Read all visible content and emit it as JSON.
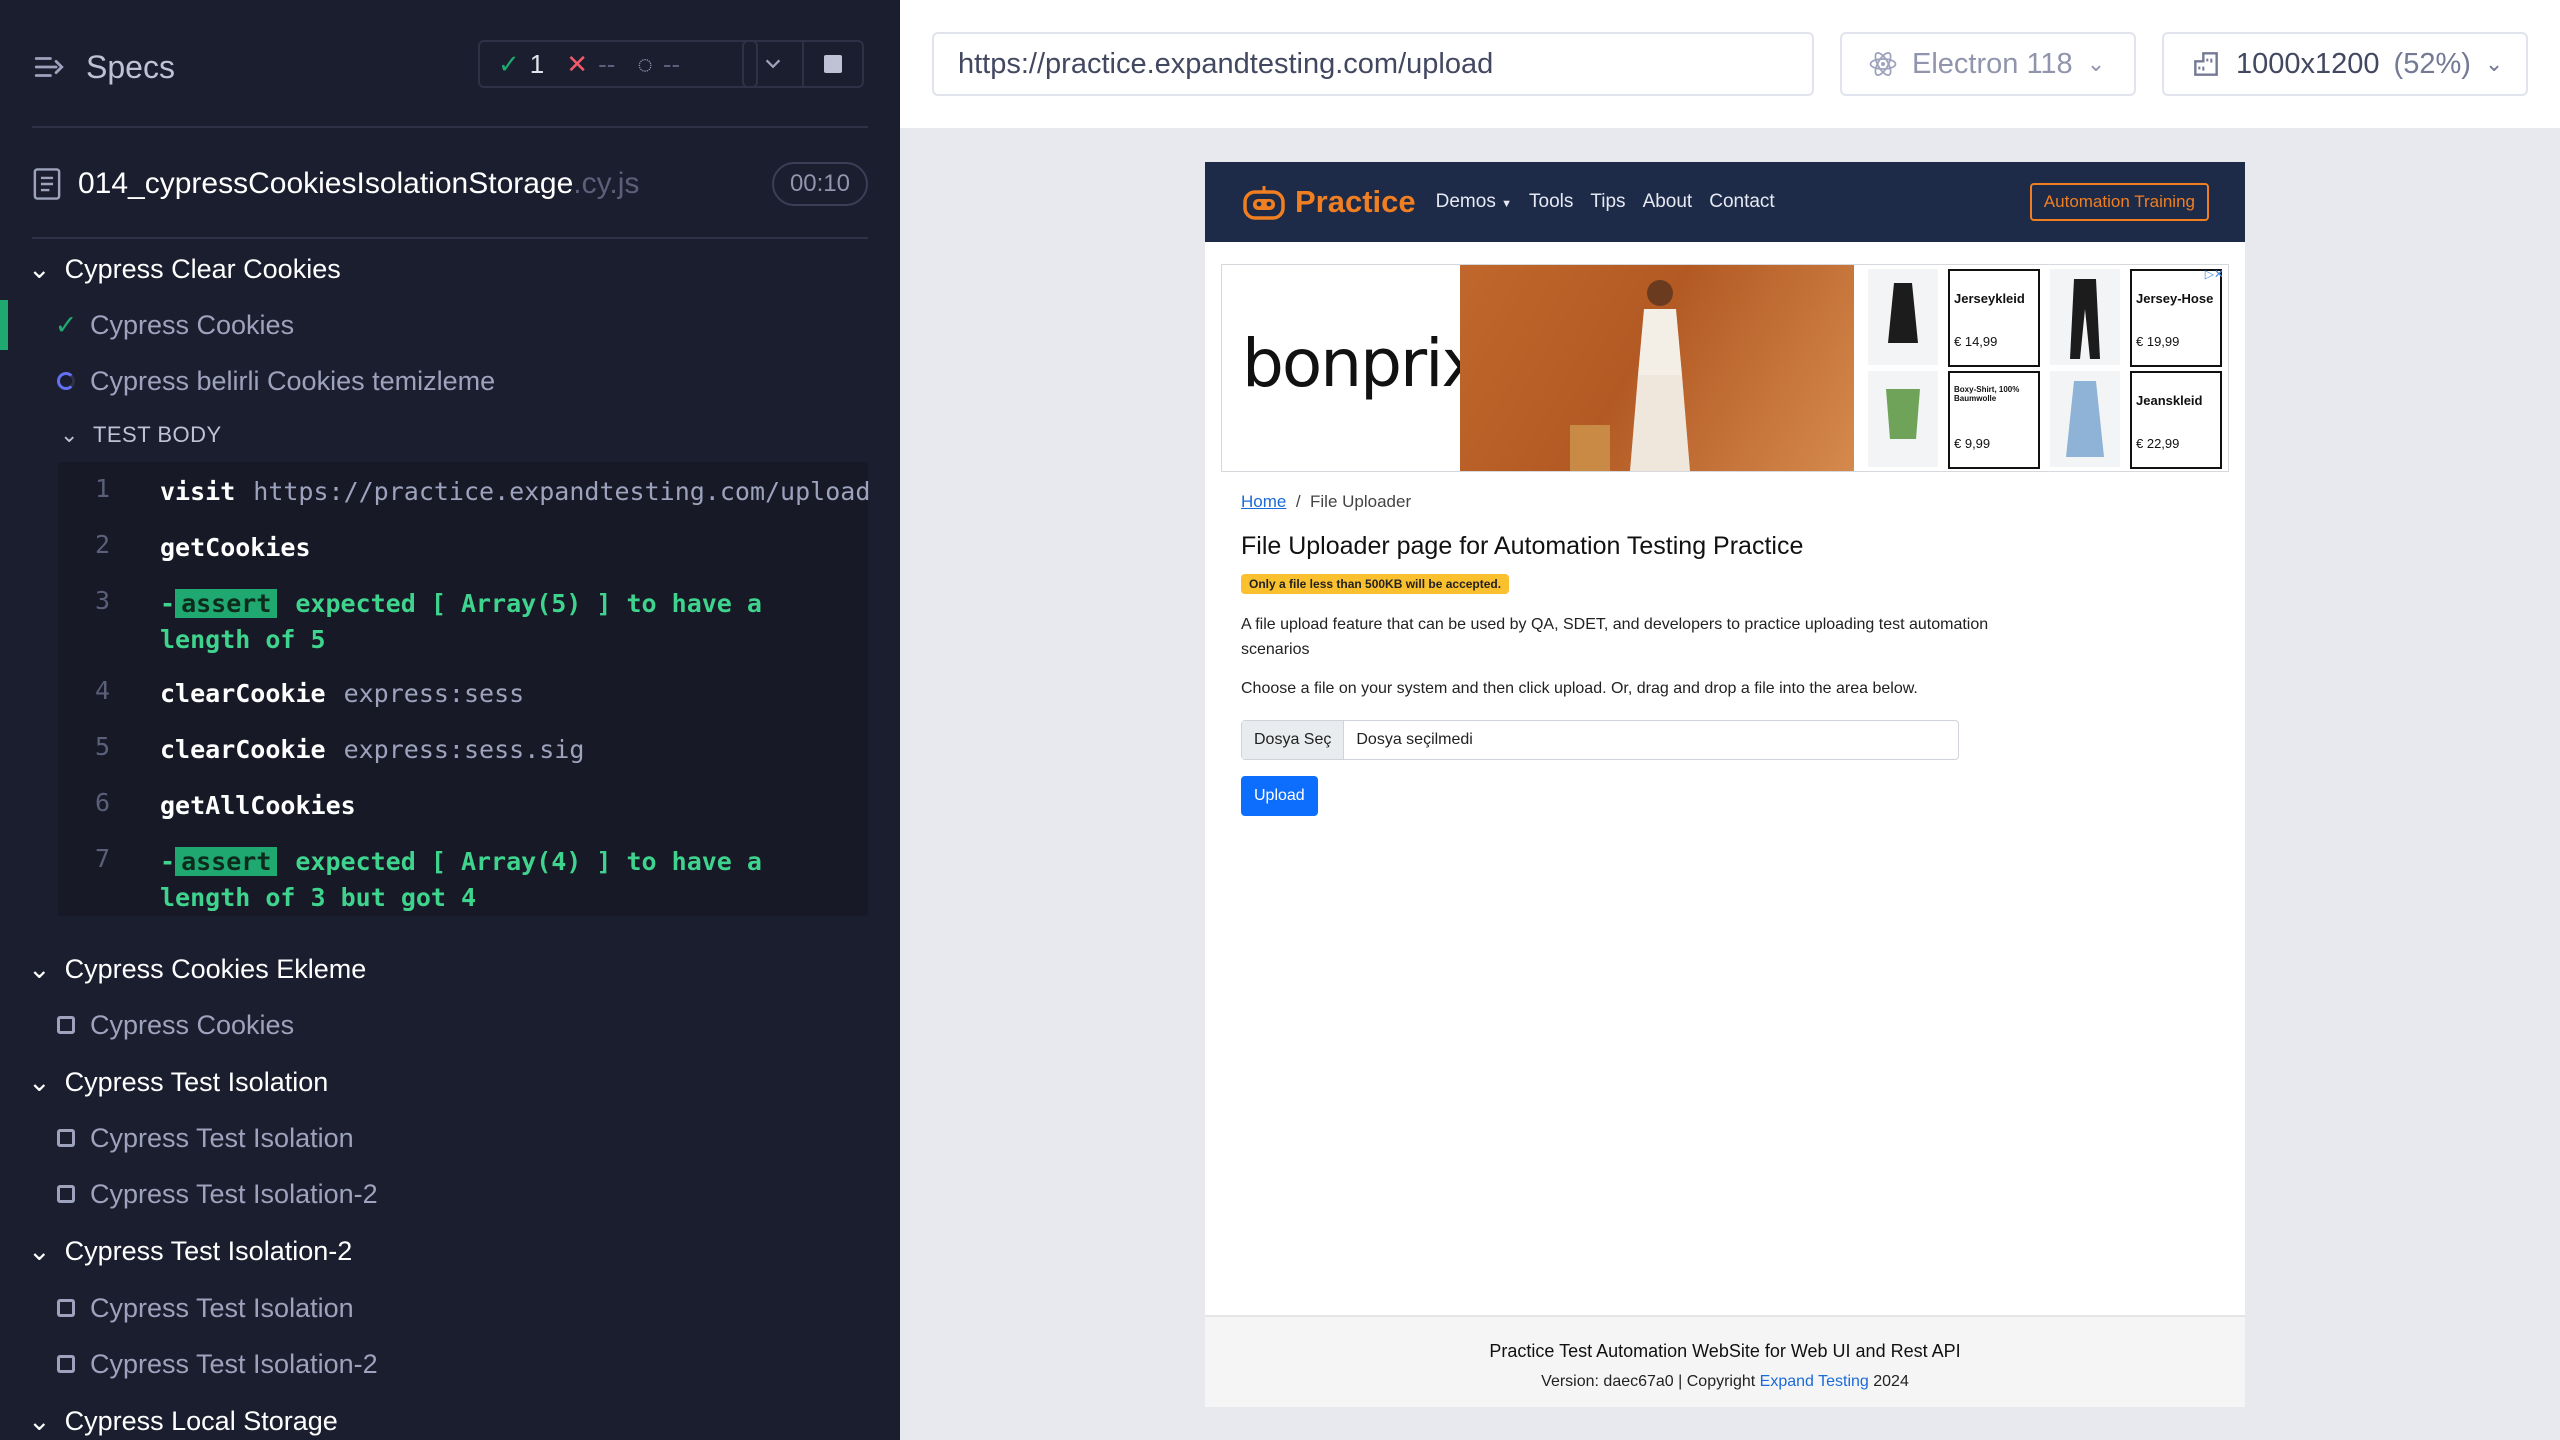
{
  "reporter": {
    "title": "Specs",
    "stats": {
      "passed": "1",
      "failed": "--",
      "pending": "--"
    },
    "spec": {
      "name": "014_cypressCookiesIsolationStorage",
      "ext": ".cy.js",
      "duration": "00:10"
    },
    "rows": [
      {
        "kind": "suite",
        "label": "Cypress Clear Cookies"
      },
      {
        "kind": "test",
        "status": "passed",
        "label": "Cypress Cookies"
      },
      {
        "kind": "test",
        "status": "running",
        "label": "Cypress belirli Cookies temizleme"
      },
      {
        "kind": "section",
        "label": "TEST BODY"
      }
    ],
    "commands": [
      {
        "num": "1",
        "name": "visit",
        "arg": "https://practice.expandtesting.com/upload"
      },
      {
        "num": "2",
        "name": "getCookies",
        "arg": ""
      },
      {
        "num": "3",
        "prefix": "-",
        "tag": "assert",
        "line1": "expected [ Array(5) ] to have a",
        "line2": "length of 5"
      },
      {
        "num": "4",
        "name": "clearCookie",
        "arg": "express:sess"
      },
      {
        "num": "5",
        "name": "clearCookie",
        "arg": "express:sess.sig"
      },
      {
        "num": "6",
        "name": "getAllCookies",
        "arg": ""
      },
      {
        "num": "7",
        "prefix": "-",
        "tag": "assert",
        "line1": "expected [ Array(4) ] to have a",
        "line2": "length of 3 but got 4"
      }
    ],
    "more_rows": [
      {
        "kind": "suite",
        "label": "Cypress Cookies Ekleme"
      },
      {
        "kind": "test",
        "status": "pending",
        "label": "Cypress Cookies"
      },
      {
        "kind": "suite",
        "label": "Cypress Test Isolation"
      },
      {
        "kind": "test",
        "status": "pending",
        "label": "Cypress Test Isolation"
      },
      {
        "kind": "test",
        "status": "pending",
        "label": "Cypress Test Isolation-2"
      },
      {
        "kind": "suite",
        "label": "Cypress Test Isolation-2"
      },
      {
        "kind": "test",
        "status": "pending",
        "label": "Cypress Test Isolation"
      },
      {
        "kind": "test",
        "status": "pending",
        "label": "Cypress Test Isolation-2"
      },
      {
        "kind": "suite",
        "label": "Cypress Local Storage"
      }
    ]
  },
  "appbar": {
    "url": "https://practice.expandtesting.com/upload",
    "browser": "Electron 118",
    "viewport": "1000x1200",
    "scale": "(52%)"
  },
  "site": {
    "brand": "Practice",
    "nav": [
      "Demos",
      "Tools",
      "Tips",
      "About",
      "Contact"
    ],
    "cta": "Automation Training",
    "ad": {
      "brand": "bonprix.",
      "cards": [
        {
          "title": "Jerseykleid",
          "price": "€ 14,99"
        },
        {
          "title": "Jersey-Hose",
          "price": "€ 19,99"
        },
        {
          "title": "Boxy-Shirt, 100% Baumwolle",
          "price": "€ 9,99"
        },
        {
          "title": "Jeanskleid",
          "price": "€ 22,99"
        }
      ],
      "badge": "▷✕"
    },
    "breadcrumb": {
      "home": "Home",
      "current": "File Uploader"
    },
    "title": "File Uploader page for Automation Testing Practice",
    "warning": "Only a file less than 500KB will be accepted.",
    "description": "A file upload feature that can be used by QA, SDET, and developers to practice uploading test automation scenarios",
    "instructions": "Choose a file on your system and then click upload. Or, drag and drop a file into the area below.",
    "file_button": "Dosya Seç",
    "file_status": "Dosya seçilmedi",
    "upload": "Upload",
    "footer": {
      "line1": "Practice Test Automation WebSite for Web UI and Rest API",
      "version_prefix": "Version: daec67a0 | Copyright ",
      "link": "Expand Testing",
      "year": " 2024"
    }
  }
}
